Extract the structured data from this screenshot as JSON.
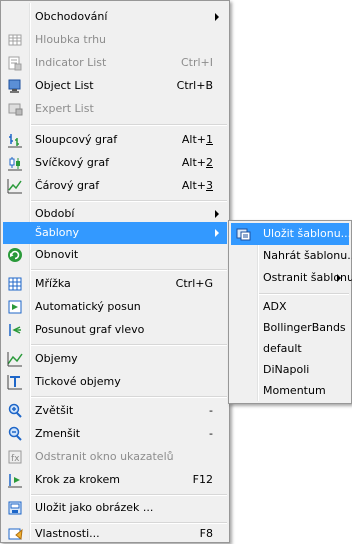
{
  "colors": {
    "menu_bg": "#f0f0f0",
    "highlight": "#3399ff",
    "disabled_text": "#8d8d8d",
    "icon_blue": "#1e66c8",
    "icon_green": "#2a9a3a"
  },
  "main_menu": {
    "items": [
      {
        "label": "Obchodování"
      },
      {
        "label": "Hloubka trhu"
      },
      {
        "label": "Indicator List",
        "shortcut": "Ctrl+I"
      },
      {
        "label": "Object List",
        "shortcut": "Ctrl+B"
      },
      {
        "label": "Expert List"
      },
      {
        "label": "Sloupcový graf",
        "shortcut_prefix": "Alt+",
        "shortcut_key": "1"
      },
      {
        "label": "Svíčkový graf",
        "shortcut_prefix": "Alt+",
        "shortcut_key": "2"
      },
      {
        "label": "Čárový graf",
        "shortcut_prefix": "Alt+",
        "shortcut_key": "3"
      },
      {
        "label": "Období"
      },
      {
        "label": "Šablony"
      },
      {
        "label": "Obnovit"
      },
      {
        "label": "Mřížka",
        "shortcut": "Ctrl+G"
      },
      {
        "label": "Automatický posun"
      },
      {
        "label": "Posunout graf vlevo"
      },
      {
        "label": "Objemy"
      },
      {
        "label": "Tickové objemy"
      },
      {
        "label": "Zvětšit",
        "shortcut": "-"
      },
      {
        "label": "Zmenšit",
        "shortcut": "-"
      },
      {
        "label": "Odstranit okno ukazatelů"
      },
      {
        "label": "Krok za krokem",
        "shortcut": "F12"
      },
      {
        "label": "Uložit jako obrázek ..."
      },
      {
        "label": "Vlastnosti...",
        "shortcut": "F8"
      }
    ]
  },
  "submenu": {
    "items": [
      {
        "label": "Uložit šablonu..."
      },
      {
        "label": "Nahrát šablonu..."
      },
      {
        "label": "Ostranit šablonu"
      },
      {
        "label": "ADX"
      },
      {
        "label": "BollingerBands"
      },
      {
        "label": "default"
      },
      {
        "label": "DiNapoli"
      },
      {
        "label": "Momentum"
      }
    ]
  }
}
